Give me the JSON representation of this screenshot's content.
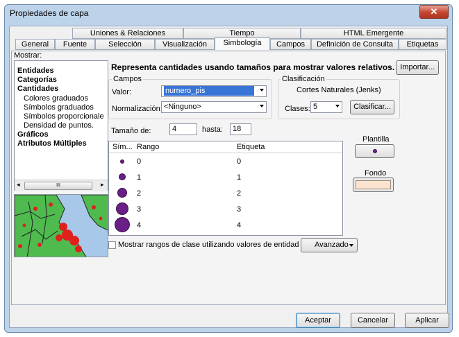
{
  "window": {
    "title": "Propiedades de capa"
  },
  "tabs_top": [
    "Uniones & Relaciones",
    "Tiempo",
    "HTML Emergente"
  ],
  "tabs_bottom": [
    "General",
    "Fuente",
    "Selección",
    "Visualización",
    "Simbología",
    "Campos",
    "Definición de Consulta",
    "Etiquetas"
  ],
  "active_tab": "Simbología",
  "show": {
    "label": "Mostrar:",
    "items": [
      "Entidades",
      "Categorías",
      "Cantidades",
      "Colores graduados",
      "Símbolos graduados",
      "Símbolos proporcionale",
      "Densidad de puntos.",
      "Gráficos",
      "Atributos Múltiples"
    ],
    "scroll_mark": "III"
  },
  "description": "Representa cantidades usando tamaños para mostrar valores relativos.",
  "import_button": "Importar...",
  "campos": {
    "legend": "Campos",
    "valor_label": "Valor:",
    "valor_value": "numero_pis",
    "normalizacion_label": "Normalización:",
    "normalizacion_value": "<Ninguno>"
  },
  "clasificacion": {
    "legend": "Clasificación",
    "method": "Cortes Naturales (Jenks)",
    "clases_label": "Clases:",
    "clases_value": "5",
    "clasificar_button": "Clasificar..."
  },
  "size": {
    "from_label": "Tamaño de:",
    "from_value": "4",
    "to_label": "hasta:",
    "to_value": "18"
  },
  "table": {
    "headers": [
      "Sím...",
      "Rango",
      "Etiqueta"
    ],
    "rows": [
      {
        "range": "0",
        "label": "0"
      },
      {
        "range": "1",
        "label": "1"
      },
      {
        "range": "2",
        "label": "2"
      },
      {
        "range": "3",
        "label": "3"
      },
      {
        "range": "4",
        "label": "4"
      }
    ],
    "symbol_color": "#6a1f86"
  },
  "plantilla": {
    "label": "Plantilla"
  },
  "fondo": {
    "label": "Fondo",
    "color": "#fbe3cf"
  },
  "show_ranges_checkbox": "Mostrar rangos de clase utilizando valores de entidad",
  "avanzado_button": "Avanzado",
  "buttons": {
    "accept": "Aceptar",
    "cancel": "Cancelar",
    "apply": "Aplicar"
  }
}
